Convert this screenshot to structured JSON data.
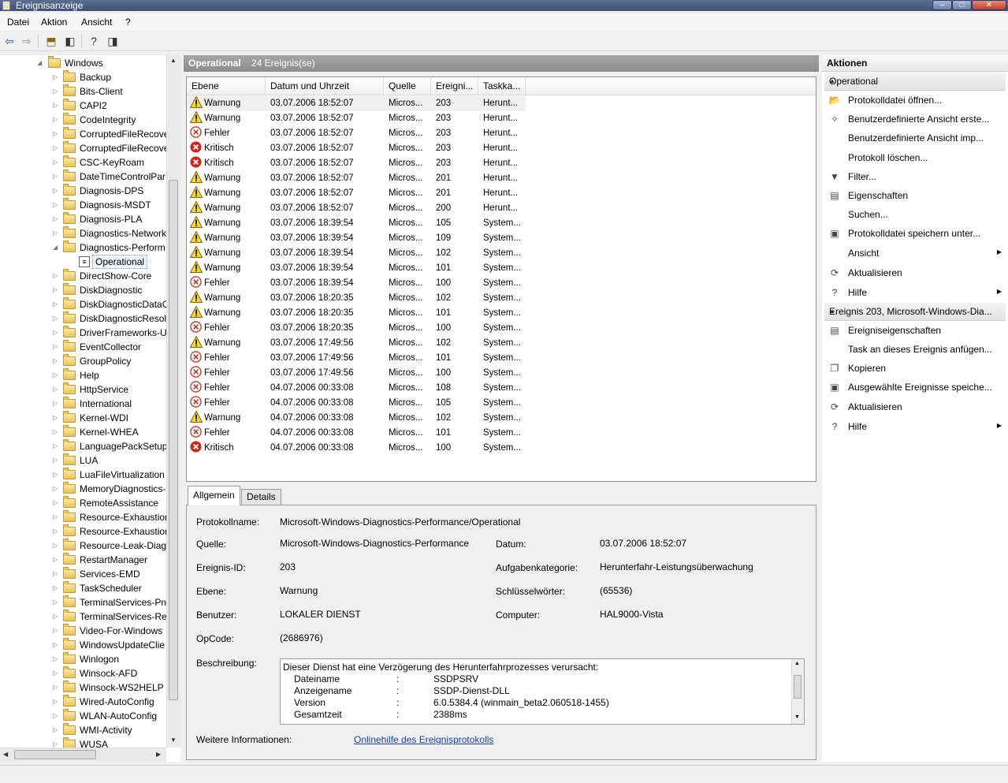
{
  "window": {
    "title": "Ereignisanzeige",
    "min": "–",
    "max": "□",
    "close": "✕"
  },
  "menu": [
    "Datei",
    "Aktion",
    "Ansicht",
    "?"
  ],
  "tree": {
    "root": "Windows",
    "items": [
      "Backup",
      "Bits-Client",
      "CAPI2",
      "CodeIntegrity",
      "CorruptedFileRecove",
      "CorruptedFileRecove",
      "CSC-KeyRoam",
      "DateTimeControlPar",
      "Diagnosis-DPS",
      "Diagnosis-MSDT",
      "Diagnosis-PLA",
      "Diagnostics-Network",
      "Diagnostics-Perform",
      "DirectShow-Core",
      "DiskDiagnostic",
      "DiskDiagnosticDataC",
      "DiskDiagnosticResol",
      "DriverFrameworks-U",
      "EventCollector",
      "GroupPolicy",
      "Help",
      "HttpService",
      "International",
      "Kernel-WDI",
      "Kernel-WHEA",
      "LanguagePackSetup",
      "LUA",
      "LuaFileVirtualization",
      "MemoryDiagnostics-",
      "RemoteAssistance",
      "Resource-Exhaustion",
      "Resource-Exhaustion",
      "Resource-Leak-Diagr",
      "RestartManager",
      "Services-EMD",
      "TaskScheduler",
      "TerminalServices-Pn",
      "TerminalServices-Re",
      "Video-For-Windows",
      "WindowsUpdateClie",
      "Winlogon",
      "Winsock-AFD",
      "Winsock-WS2HELP",
      "Wired-AutoConfig",
      "WLAN-AutoConfig",
      "WMI-Activity",
      "WUSA"
    ],
    "expanded_index": 12,
    "child": "Operational"
  },
  "center": {
    "title": "Operational",
    "count": "24 Ereignis(se)"
  },
  "columns": [
    "Ebene",
    "Datum und Uhrzeit",
    "Quelle",
    "Ereigni...",
    "Taskka..."
  ],
  "events": [
    {
      "level": "Warnung",
      "type": "warn",
      "date": "03.07.2006 18:52:07",
      "source": "Micros...",
      "id": "203",
      "task": "Herunt..."
    },
    {
      "level": "Warnung",
      "type": "warn",
      "date": "03.07.2006 18:52:07",
      "source": "Micros...",
      "id": "203",
      "task": "Herunt..."
    },
    {
      "level": "Fehler",
      "type": "err",
      "date": "03.07.2006 18:52:07",
      "source": "Micros...",
      "id": "203",
      "task": "Herunt..."
    },
    {
      "level": "Kritisch",
      "type": "crit",
      "date": "03.07.2006 18:52:07",
      "source": "Micros...",
      "id": "203",
      "task": "Herunt..."
    },
    {
      "level": "Kritisch",
      "type": "crit",
      "date": "03.07.2006 18:52:07",
      "source": "Micros...",
      "id": "203",
      "task": "Herunt..."
    },
    {
      "level": "Warnung",
      "type": "warn",
      "date": "03.07.2006 18:52:07",
      "source": "Micros...",
      "id": "201",
      "task": "Herunt..."
    },
    {
      "level": "Warnung",
      "type": "warn",
      "date": "03.07.2006 18:52:07",
      "source": "Micros...",
      "id": "201",
      "task": "Herunt..."
    },
    {
      "level": "Warnung",
      "type": "warn",
      "date": "03.07.2006 18:52:07",
      "source": "Micros...",
      "id": "200",
      "task": "Herunt..."
    },
    {
      "level": "Warnung",
      "type": "warn",
      "date": "03.07.2006 18:39:54",
      "source": "Micros...",
      "id": "105",
      "task": "System..."
    },
    {
      "level": "Warnung",
      "type": "warn",
      "date": "03.07.2006 18:39:54",
      "source": "Micros...",
      "id": "109",
      "task": "System..."
    },
    {
      "level": "Warnung",
      "type": "warn",
      "date": "03.07.2006 18:39:54",
      "source": "Micros...",
      "id": "102",
      "task": "System..."
    },
    {
      "level": "Warnung",
      "type": "warn",
      "date": "03.07.2006 18:39:54",
      "source": "Micros...",
      "id": "101",
      "task": "System..."
    },
    {
      "level": "Fehler",
      "type": "err",
      "date": "03.07.2006 18:39:54",
      "source": "Micros...",
      "id": "100",
      "task": "System..."
    },
    {
      "level": "Warnung",
      "type": "warn",
      "date": "03.07.2006 18:20:35",
      "source": "Micros...",
      "id": "102",
      "task": "System..."
    },
    {
      "level": "Warnung",
      "type": "warn",
      "date": "03.07.2006 18:20:35",
      "source": "Micros...",
      "id": "101",
      "task": "System..."
    },
    {
      "level": "Fehler",
      "type": "err",
      "date": "03.07.2006 18:20:35",
      "source": "Micros...",
      "id": "100",
      "task": "System..."
    },
    {
      "level": "Warnung",
      "type": "warn",
      "date": "03.07.2006 17:49:56",
      "source": "Micros...",
      "id": "102",
      "task": "System..."
    },
    {
      "level": "Fehler",
      "type": "err",
      "date": "03.07.2006 17:49:56",
      "source": "Micros...",
      "id": "101",
      "task": "System..."
    },
    {
      "level": "Fehler",
      "type": "err",
      "date": "03.07.2006 17:49:56",
      "source": "Micros...",
      "id": "100",
      "task": "System..."
    },
    {
      "level": "Fehler",
      "type": "err",
      "date": "04.07.2006 00:33:08",
      "source": "Micros...",
      "id": "108",
      "task": "System..."
    },
    {
      "level": "Fehler",
      "type": "err",
      "date": "04.07.2006 00:33:08",
      "source": "Micros...",
      "id": "105",
      "task": "System..."
    },
    {
      "level": "Warnung",
      "type": "warn",
      "date": "04.07.2006 00:33:08",
      "source": "Micros...",
      "id": "102",
      "task": "System..."
    },
    {
      "level": "Fehler",
      "type": "err",
      "date": "04.07.2006 00:33:08",
      "source": "Micros...",
      "id": "101",
      "task": "System..."
    },
    {
      "level": "Kritisch",
      "type": "crit",
      "date": "04.07.2006 00:33:08",
      "source": "Micros...",
      "id": "100",
      "task": "System..."
    }
  ],
  "tabs": {
    "general": "Allgemein",
    "details": "Details"
  },
  "detail": {
    "log_name_label": "Protokollname:",
    "log_name": "Microsoft-Windows-Diagnostics-Performance/Operational",
    "source_label": "Quelle:",
    "source": "Microsoft-Windows-Diagnostics-Performance",
    "date_label": "Datum:",
    "date": "03.07.2006 18:52:07",
    "event_id_label": "Ereignis-ID:",
    "event_id": "203",
    "task_label": "Aufgabenkategorie:",
    "task": "Herunterfahr-Leistungsüberwachung",
    "level_label": "Ebene:",
    "level": "Warnung",
    "keywords_label": "Schlüsselwörter:",
    "keywords": "(65536)",
    "user_label": "Benutzer:",
    "user": "LOKALER DIENST",
    "computer_label": "Computer:",
    "computer": "HAL9000-Vista",
    "opcode_label": "OpCode:",
    "opcode": "(2686976)",
    "desc_label": "Beschreibung:",
    "desc_intro": "Dieser Dienst hat eine Verzögerung des Herunterfahrprozesses verursacht:",
    "desc_lines": [
      {
        "k": "Dateiname",
        "v": "SSDPSRV"
      },
      {
        "k": "Anzeigename",
        "v": "SSDP-Dienst-DLL"
      },
      {
        "k": "Version",
        "v": "6.0.5384.4 (winmain_beta2.060518-1455)"
      },
      {
        "k": "Gesamtzeit",
        "v": "2388ms"
      }
    ],
    "desc_sep": ":",
    "more_label": "Weitere Informationen:",
    "more_link": "Onlinehilfe des Ereignisprotokolls"
  },
  "actions": {
    "title": "Aktionen",
    "section1": "Operational",
    "items1": [
      {
        "label": "Protokolldatei öffnen...",
        "icon": "folder-open-icon",
        "g": "📂"
      },
      {
        "label": "Benutzerdefinierte Ansicht erste...",
        "icon": "magic-filter-icon",
        "g": "✧"
      },
      {
        "label": "Benutzerdefinierte Ansicht imp...",
        "icon": "",
        "g": ""
      },
      {
        "label": "Protokoll löschen...",
        "icon": "",
        "g": ""
      },
      {
        "label": "Filter...",
        "icon": "filter-icon",
        "g": "▼"
      },
      {
        "label": "Eigenschaften",
        "icon": "properties-icon",
        "g": "▤"
      },
      {
        "label": "Suchen...",
        "icon": "",
        "g": ""
      },
      {
        "label": "Protokolldatei speichern unter...",
        "icon": "save-icon",
        "g": "▣"
      },
      {
        "label": "Ansicht",
        "icon": "",
        "g": "",
        "sub": true
      },
      {
        "label": "Aktualisieren",
        "icon": "refresh-icon",
        "g": "⟳"
      },
      {
        "label": "Hilfe",
        "icon": "help-icon",
        "g": "?",
        "sub": true
      }
    ],
    "section2": "Ereignis 203, Microsoft-Windows-Dia...",
    "items2": [
      {
        "label": "Ereigniseigenschaften",
        "icon": "properties-icon",
        "g": "▤"
      },
      {
        "label": "Task an dieses Ereignis anfügen...",
        "icon": "",
        "g": ""
      },
      {
        "label": "Kopieren",
        "icon": "copy-icon",
        "g": "❐"
      },
      {
        "label": "Ausgewählte Ereignisse speiche...",
        "icon": "save-icon",
        "g": "▣"
      },
      {
        "label": "Aktualisieren",
        "icon": "refresh-icon",
        "g": "⟳"
      },
      {
        "label": "Hilfe",
        "icon": "help-icon",
        "g": "?",
        "sub": true
      }
    ]
  }
}
